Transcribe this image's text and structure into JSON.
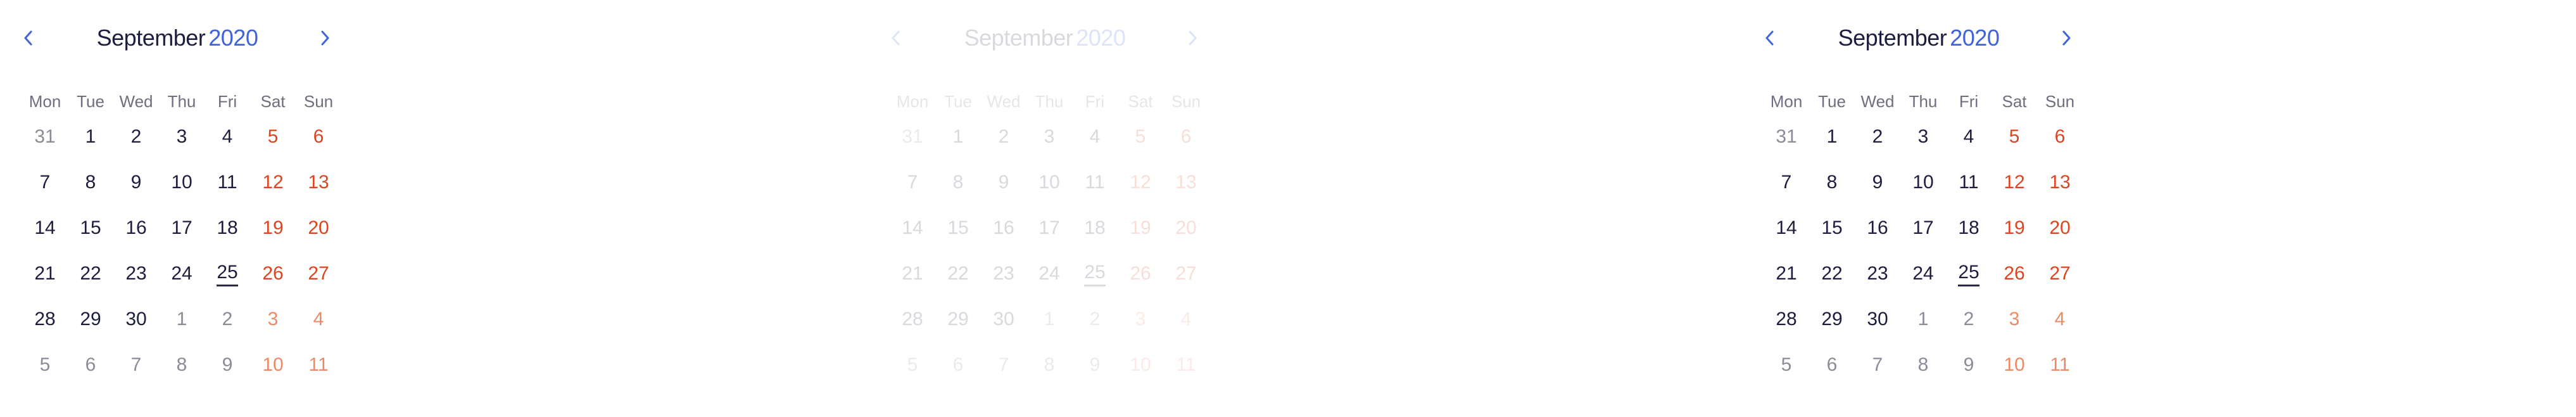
{
  "calendars": [
    {
      "month": "September",
      "year": "2020",
      "state": "normal",
      "weekdays": [
        "Mon",
        "Tue",
        "Wed",
        "Thu",
        "Fri",
        "Sat",
        "Sun"
      ],
      "days": [
        {
          "n": "31",
          "out": true
        },
        {
          "n": "1"
        },
        {
          "n": "2"
        },
        {
          "n": "3"
        },
        {
          "n": "4"
        },
        {
          "n": "5",
          "we": true
        },
        {
          "n": "6",
          "we": true
        },
        {
          "n": "7"
        },
        {
          "n": "8"
        },
        {
          "n": "9"
        },
        {
          "n": "10"
        },
        {
          "n": "11"
        },
        {
          "n": "12",
          "we": true
        },
        {
          "n": "13",
          "we": true
        },
        {
          "n": "14"
        },
        {
          "n": "15"
        },
        {
          "n": "16"
        },
        {
          "n": "17"
        },
        {
          "n": "18"
        },
        {
          "n": "19",
          "we": true
        },
        {
          "n": "20",
          "we": true
        },
        {
          "n": "21"
        },
        {
          "n": "22"
        },
        {
          "n": "23"
        },
        {
          "n": "24"
        },
        {
          "n": "25",
          "today": true
        },
        {
          "n": "26",
          "we": true
        },
        {
          "n": "27",
          "we": true
        },
        {
          "n": "28"
        },
        {
          "n": "29"
        },
        {
          "n": "30"
        },
        {
          "n": "1",
          "out": true
        },
        {
          "n": "2",
          "out": true
        },
        {
          "n": "3",
          "out": true,
          "we": true
        },
        {
          "n": "4",
          "out": true,
          "we": true
        },
        {
          "n": "5",
          "out": true
        },
        {
          "n": "6",
          "out": true
        },
        {
          "n": "7",
          "out": true
        },
        {
          "n": "8",
          "out": true
        },
        {
          "n": "9",
          "out": true
        },
        {
          "n": "10",
          "out": true,
          "we": true
        },
        {
          "n": "11",
          "out": true,
          "we": true
        }
      ]
    },
    {
      "month": "September",
      "year": "2020",
      "state": "disabled",
      "weekdays": [
        "Mon",
        "Tue",
        "Wed",
        "Thu",
        "Fri",
        "Sat",
        "Sun"
      ],
      "days": [
        {
          "n": "31",
          "out": true
        },
        {
          "n": "1"
        },
        {
          "n": "2"
        },
        {
          "n": "3"
        },
        {
          "n": "4"
        },
        {
          "n": "5",
          "we": true
        },
        {
          "n": "6",
          "we": true
        },
        {
          "n": "7"
        },
        {
          "n": "8"
        },
        {
          "n": "9"
        },
        {
          "n": "10"
        },
        {
          "n": "11"
        },
        {
          "n": "12",
          "we": true
        },
        {
          "n": "13",
          "we": true
        },
        {
          "n": "14"
        },
        {
          "n": "15"
        },
        {
          "n": "16"
        },
        {
          "n": "17"
        },
        {
          "n": "18"
        },
        {
          "n": "19",
          "we": true
        },
        {
          "n": "20",
          "we": true
        },
        {
          "n": "21"
        },
        {
          "n": "22"
        },
        {
          "n": "23"
        },
        {
          "n": "24"
        },
        {
          "n": "25",
          "today": true
        },
        {
          "n": "26",
          "we": true
        },
        {
          "n": "27",
          "we": true
        },
        {
          "n": "28"
        },
        {
          "n": "29"
        },
        {
          "n": "30"
        },
        {
          "n": "1",
          "out": true
        },
        {
          "n": "2",
          "out": true
        },
        {
          "n": "3",
          "out": true,
          "we": true
        },
        {
          "n": "4",
          "out": true,
          "we": true
        },
        {
          "n": "5",
          "out": true
        },
        {
          "n": "6",
          "out": true
        },
        {
          "n": "7",
          "out": true
        },
        {
          "n": "8",
          "out": true
        },
        {
          "n": "9",
          "out": true
        },
        {
          "n": "10",
          "out": true,
          "we": true
        },
        {
          "n": "11",
          "out": true,
          "we": true
        }
      ]
    },
    {
      "month": "September",
      "year": "2020",
      "state": "normal",
      "weekdays": [
        "Mon",
        "Tue",
        "Wed",
        "Thu",
        "Fri",
        "Sat",
        "Sun"
      ],
      "days": [
        {
          "n": "31",
          "out": true
        },
        {
          "n": "1"
        },
        {
          "n": "2"
        },
        {
          "n": "3"
        },
        {
          "n": "4"
        },
        {
          "n": "5",
          "we": true
        },
        {
          "n": "6",
          "we": true
        },
        {
          "n": "7"
        },
        {
          "n": "8"
        },
        {
          "n": "9"
        },
        {
          "n": "10"
        },
        {
          "n": "11"
        },
        {
          "n": "12",
          "we": true
        },
        {
          "n": "13",
          "we": true
        },
        {
          "n": "14"
        },
        {
          "n": "15"
        },
        {
          "n": "16"
        },
        {
          "n": "17"
        },
        {
          "n": "18"
        },
        {
          "n": "19",
          "we": true
        },
        {
          "n": "20",
          "we": true
        },
        {
          "n": "21"
        },
        {
          "n": "22"
        },
        {
          "n": "23"
        },
        {
          "n": "24"
        },
        {
          "n": "25",
          "today": true
        },
        {
          "n": "26",
          "we": true
        },
        {
          "n": "27",
          "we": true
        },
        {
          "n": "28"
        },
        {
          "n": "29"
        },
        {
          "n": "30"
        },
        {
          "n": "1",
          "out": true
        },
        {
          "n": "2",
          "out": true
        },
        {
          "n": "3",
          "out": true,
          "we": true
        },
        {
          "n": "4",
          "out": true,
          "we": true
        },
        {
          "n": "5",
          "out": true
        },
        {
          "n": "6",
          "out": true
        },
        {
          "n": "7",
          "out": true
        },
        {
          "n": "8",
          "out": true
        },
        {
          "n": "9",
          "out": true
        },
        {
          "n": "10",
          "out": true,
          "we": true
        },
        {
          "n": "11",
          "out": true,
          "we": true
        }
      ]
    }
  ],
  "icons": {
    "prev": "chevron-left-icon",
    "next": "chevron-right-icon"
  },
  "colors": {
    "accent": "#3e63dd",
    "text": "#1d1d3f",
    "weekend": "#e0441f",
    "weekend_outside": "#ee8a63",
    "outside": "#8b8b99"
  }
}
